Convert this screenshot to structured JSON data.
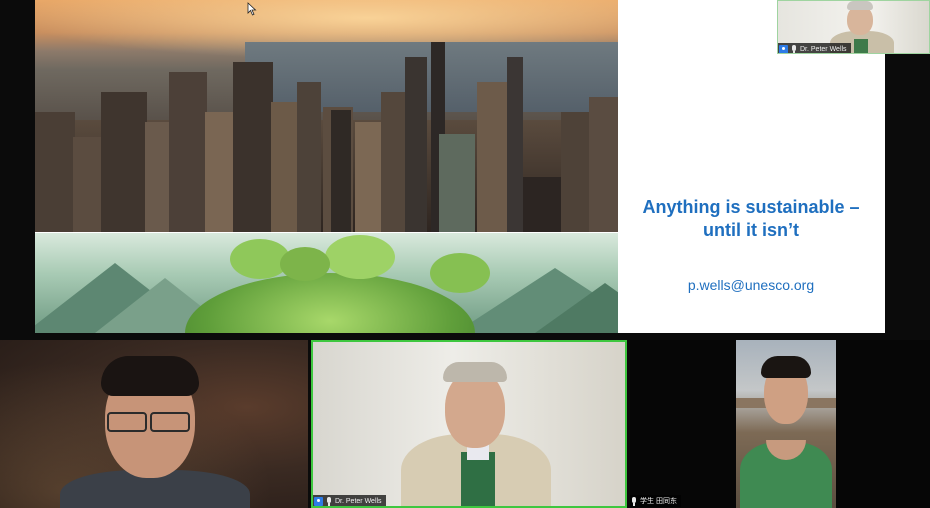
{
  "slide": {
    "title_line1": "Anything is sustainable –",
    "title_line2": "until it isn’t",
    "email": "p.wells@unesco.org",
    "accent_color": "#1f6fbf"
  },
  "participants": {
    "self_view": {
      "name": "Dr. Peter Wells",
      "mic_icon": "mic-icon",
      "badge_icon": "host-badge-icon"
    },
    "speaker": {
      "name": "Dr. Peter Wells",
      "mic_icon": "mic-icon",
      "badge_icon": "host-badge-icon",
      "border_color": "#3ec73f"
    },
    "right_participant": {
      "name": "学生 田同东",
      "mic_icon": "mic-icon"
    },
    "left_participant": {
      "name": ""
    }
  },
  "icons": [
    "mouse-cursor-icon",
    "mic-icon",
    "host-badge-icon"
  ]
}
